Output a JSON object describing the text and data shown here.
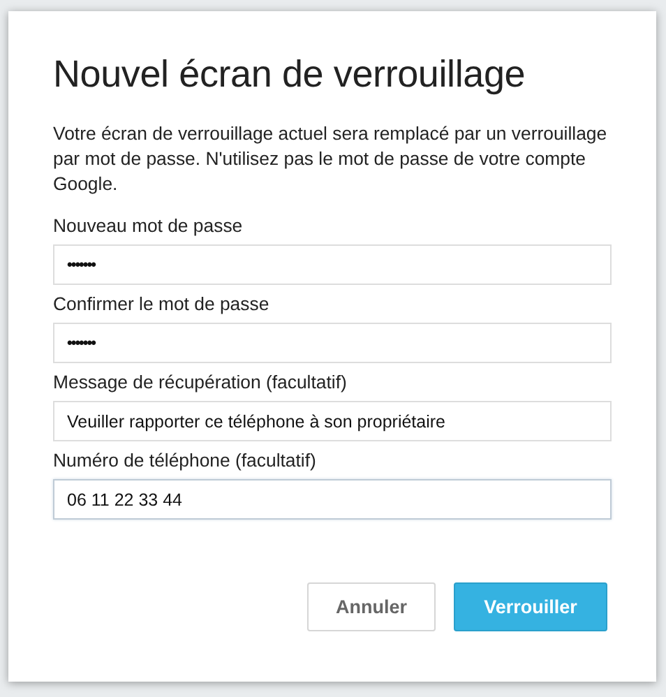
{
  "dialog": {
    "title": "Nouvel écran de verrouillage",
    "description": "Votre écran de verrouillage actuel sera remplacé par un verrouillage par mot de passe. N'utilisez pas le mot de passe de votre compte Google.",
    "fields": [
      {
        "label": "Nouveau mot de passe",
        "kind": "password",
        "value": "•••••••",
        "focused": false
      },
      {
        "label": "Confirmer le mot de passe",
        "kind": "password",
        "value": "•••••••",
        "focused": false
      },
      {
        "label": "Message de récupération (facultatif)",
        "kind": "text",
        "value": "Veuiller rapporter ce téléphone à son propriétaire",
        "focused": false
      },
      {
        "label": "Numéro de téléphone (facultatif)",
        "kind": "text",
        "value": "06 11 22 33 44",
        "focused": true
      }
    ],
    "buttons": [
      {
        "label": "Annuler",
        "kind": "secondary"
      },
      {
        "label": "Verrouiller",
        "kind": "primary"
      }
    ]
  }
}
